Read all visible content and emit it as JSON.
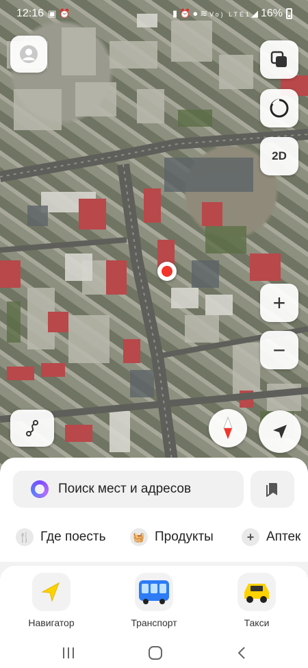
{
  "status_bar": {
    "time": "12:16",
    "left_icons": [
      "image-icon",
      "alarm-icon"
    ],
    "right_icons": [
      "battery-saver-icon",
      "alarm-icon",
      "location-icon",
      "wifi-icon",
      "volte-icon",
      "signal-icon"
    ],
    "volte_label": "Vo) LTE1",
    "battery": "16%"
  },
  "map": {
    "view_mode_label": "2D",
    "zoom_in_label": "+",
    "zoom_out_label": "−",
    "pin_color": "#f2352b"
  },
  "search": {
    "placeholder": "Поиск мест и адресов"
  },
  "categories": [
    {
      "label": "Где поесть",
      "icon": "fork-knife-icon"
    },
    {
      "label": "Продукты",
      "icon": "basket-icon"
    },
    {
      "label": "Аптек",
      "icon": "plus-icon"
    }
  ],
  "services": [
    {
      "label": "Навигатор",
      "icon": "navigator-arrow-icon"
    },
    {
      "label": "Транспорт",
      "icon": "bus-icon"
    },
    {
      "label": "Такси",
      "icon": "taxi-icon"
    }
  ],
  "colors": {
    "accent_yellow": "#fcd200",
    "alice_purple": "#7a4cff",
    "bus_blue": "#2d7cf6"
  }
}
